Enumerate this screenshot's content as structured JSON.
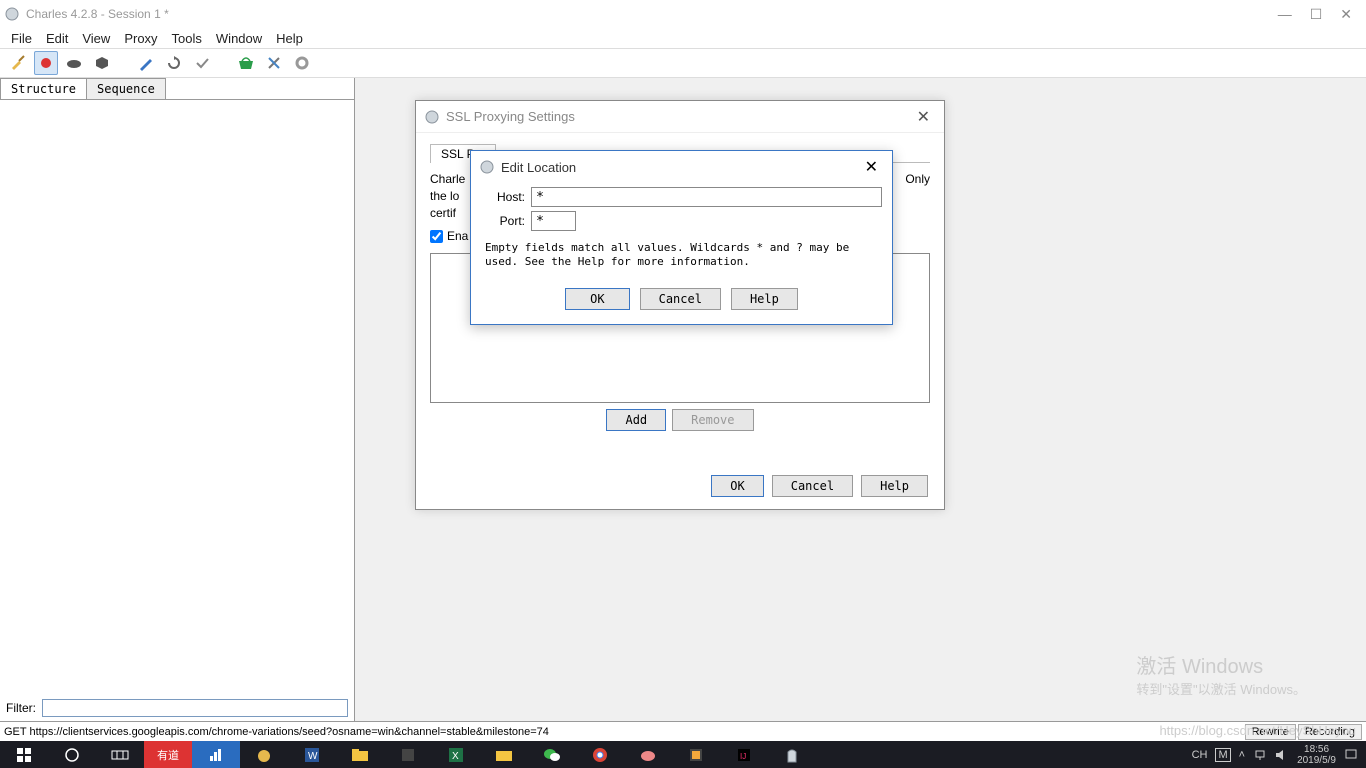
{
  "titlebar": {
    "title": "Charles 4.2.8 - Session 1 *"
  },
  "menu": [
    "File",
    "Edit",
    "View",
    "Proxy",
    "Tools",
    "Window",
    "Help"
  ],
  "tabs": {
    "structure": "Structure",
    "sequence": "Sequence"
  },
  "filter": {
    "label": "Filter:"
  },
  "status": {
    "text": "GET https://clientservices.googleapis.com/chrome-variations/seed?osname=win&channel=stable&milestone=74",
    "rewrite": "Rewrite",
    "recording": "Recording"
  },
  "ssl_dialog": {
    "title": "SSL Proxying Settings",
    "tab": "SSL Pro",
    "desc_start": "Charle",
    "desc_line2": "the lo",
    "desc_line3": "certif",
    "desc_right": "Only",
    "enable": "Ena",
    "add": "Add",
    "remove": "Remove",
    "ok": "OK",
    "cancel": "Cancel",
    "help": "Help"
  },
  "edit_dialog": {
    "title": "Edit Location",
    "host_label": "Host:",
    "host_value": "*",
    "port_label": "Port:",
    "port_value": "*",
    "helptext": "Empty fields match all values. Wildcards * and ? may be used. See the Help for more information.",
    "ok": "OK",
    "cancel": "Cancel",
    "help": "Help"
  },
  "watermark": {
    "big": "激活 Windows",
    "small": "转到\"设置\"以激活 Windows。"
  },
  "csdn": "https://blog.csdn.net/HeyShHeyou",
  "tray": {
    "ime": "CH",
    "m": "M",
    "time": "18:56",
    "date": "2019/5/9"
  }
}
